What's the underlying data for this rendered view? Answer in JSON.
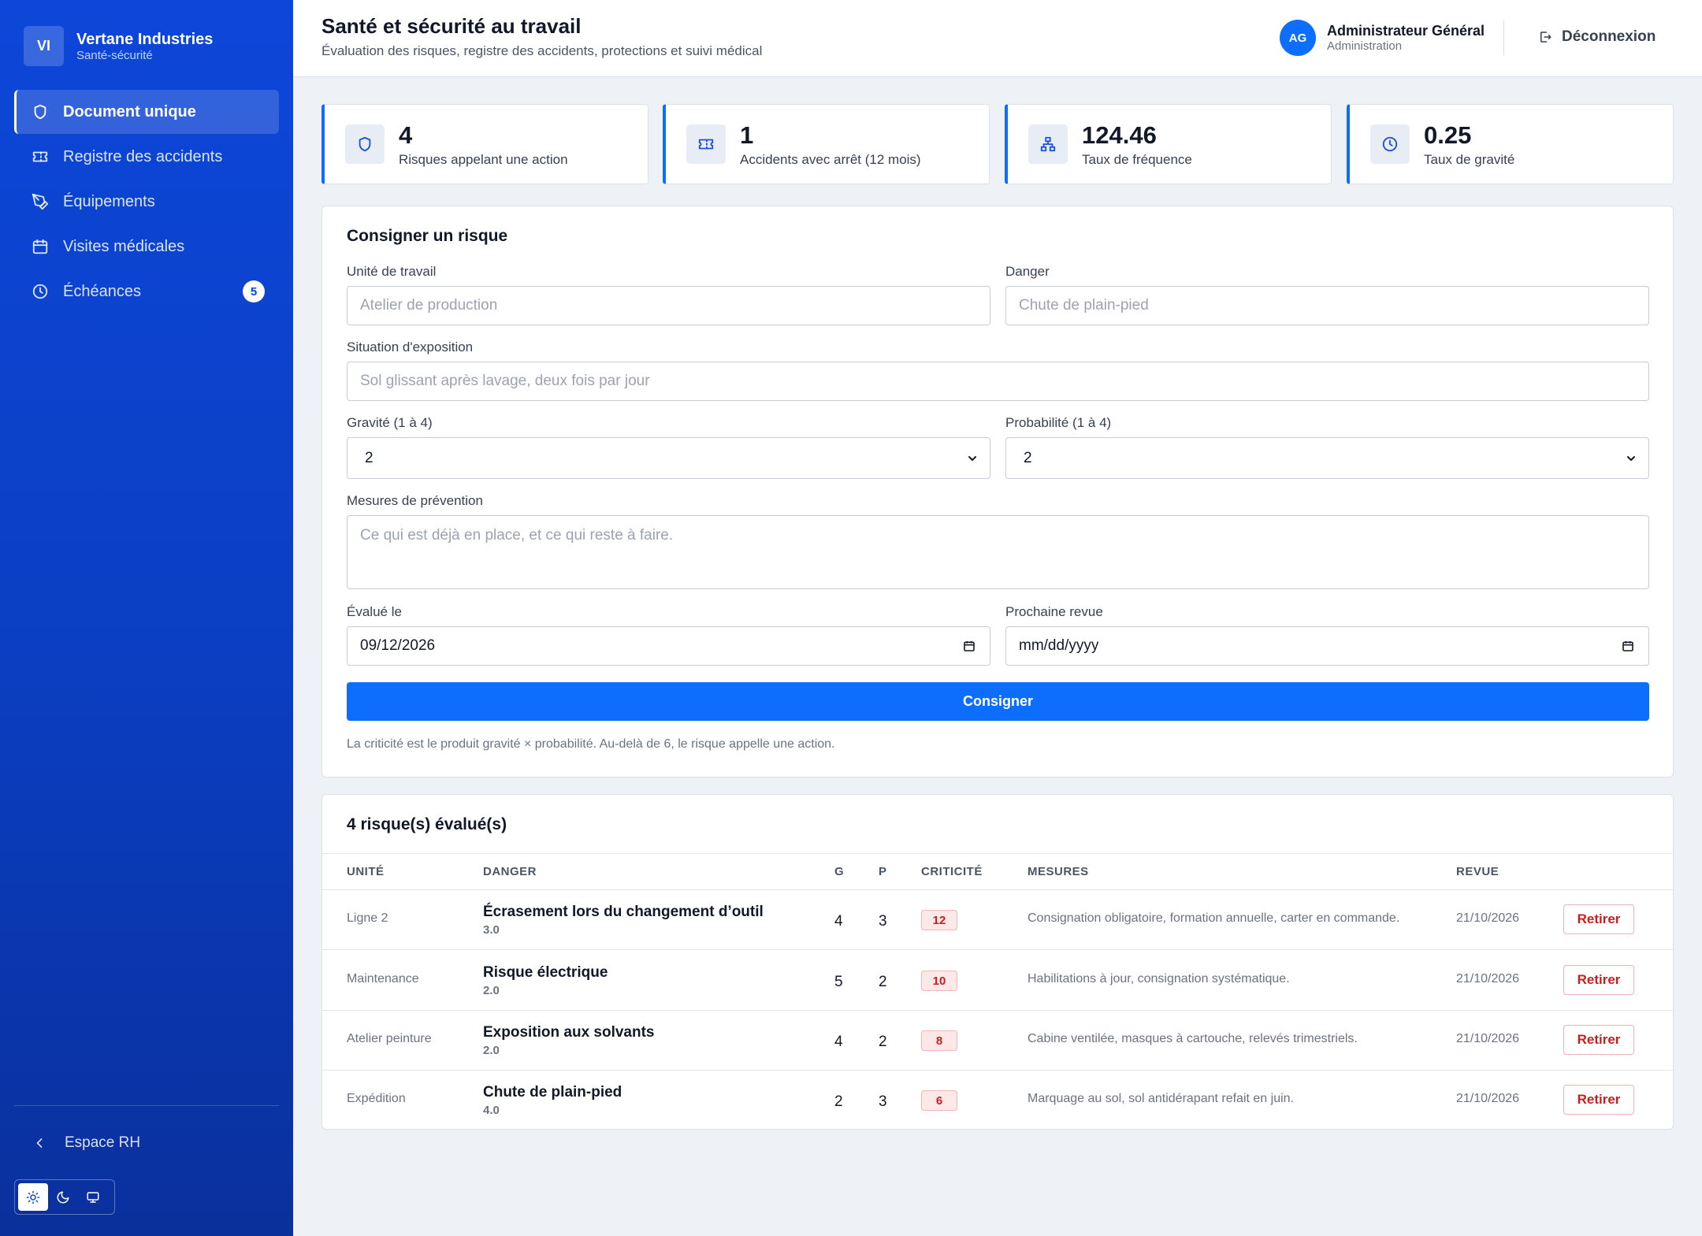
{
  "brand": {
    "initials": "VI",
    "name": "Vertane Industries",
    "subtitle": "Santé-sécurité"
  },
  "sidebar": {
    "items": [
      {
        "label": "Document unique",
        "icon": "shield-icon",
        "active": true
      },
      {
        "label": "Registre des accidents",
        "icon": "ticket-icon"
      },
      {
        "label": "Équipements",
        "icon": "pen-tool-icon"
      },
      {
        "label": "Visites médicales",
        "icon": "calendar-icon"
      },
      {
        "label": "Échéances",
        "icon": "clock-icon",
        "badge": "5"
      }
    ],
    "back_label": "Espace RH",
    "theme_options": [
      "sun-icon",
      "moon-icon",
      "monitor-icon"
    ]
  },
  "header": {
    "title": "Santé et sécurité au travail",
    "subtitle": "Évaluation des risques, registre des accidents, protections et suivi médical",
    "user": {
      "initials": "AG",
      "name": "Administrateur Général",
      "role": "Administration"
    },
    "logout_label": "Déconnexion"
  },
  "stats": [
    {
      "value": "4",
      "label": "Risques appelant une action",
      "icon": "shield-icon"
    },
    {
      "value": "1",
      "label": "Accidents avec arrêt (12 mois)",
      "icon": "ticket-icon"
    },
    {
      "value": "124.46",
      "label": "Taux de fréquence",
      "icon": "hierarchy-icon"
    },
    {
      "value": "0.25",
      "label": "Taux de gravité",
      "icon": "clock-icon"
    }
  ],
  "form": {
    "title": "Consigner un risque",
    "unite": {
      "label": "Unité de travail",
      "placeholder": "Atelier de production"
    },
    "danger": {
      "label": "Danger",
      "placeholder": "Chute de plain-pied"
    },
    "situation": {
      "label": "Situation d'exposition",
      "placeholder": "Sol glissant après lavage, deux fois par jour"
    },
    "gravite": {
      "label": "Gravité (1 à 4)",
      "value": "2"
    },
    "probabilite": {
      "label": "Probabilité (1 à 4)",
      "value": "2"
    },
    "mesures": {
      "label": "Mesures de prévention",
      "placeholder": "Ce qui est déjà en place, et ce qui reste à faire."
    },
    "evalue": {
      "label": "Évalué le",
      "value": "09/12/2026"
    },
    "revue": {
      "label": "Prochaine revue",
      "value": "mm/dd/yyyy"
    },
    "submit_label": "Consigner",
    "hint": "La criticité est le produit gravité × probabilité. Au-delà de 6, le risque appelle une action."
  },
  "table": {
    "title": "4 risque(s) évalué(s)",
    "columns": [
      "UNITÉ",
      "DANGER",
      "G",
      "P",
      "CRITICITÉ",
      "MESURES",
      "REVUE"
    ],
    "action_label": "Retirer",
    "rows": [
      {
        "unite": "Ligne 2",
        "danger": "Écrasement lors du changement d’outil",
        "sub": "3.0",
        "g": "4",
        "p": "3",
        "crit": "12",
        "mesures": "Consignation obligatoire, formation annuelle, carter en commande.",
        "revue": "21/10/2026"
      },
      {
        "unite": "Maintenance",
        "danger": "Risque électrique",
        "sub": "2.0",
        "g": "5",
        "p": "2",
        "crit": "10",
        "mesures": "Habilitations à jour, consignation systématique.",
        "revue": "21/10/2026"
      },
      {
        "unite": "Atelier peinture",
        "danger": "Exposition aux solvants",
        "sub": "2.0",
        "g": "4",
        "p": "2",
        "crit": "8",
        "mesures": "Cabine ventilée, masques à cartouche, relevés trimestriels.",
        "revue": "21/10/2026"
      },
      {
        "unite": "Expédition",
        "danger": "Chute de plain-pied",
        "sub": "4.0",
        "g": "2",
        "p": "3",
        "crit": "6",
        "mesures": "Marquage au sol, sol antidérapant refait en juin.",
        "revue": "21/10/2026"
      }
    ]
  },
  "colors": {
    "primary": "#0d6efd",
    "sidebar": "#0b3fc4",
    "danger": "#c81e1e"
  }
}
